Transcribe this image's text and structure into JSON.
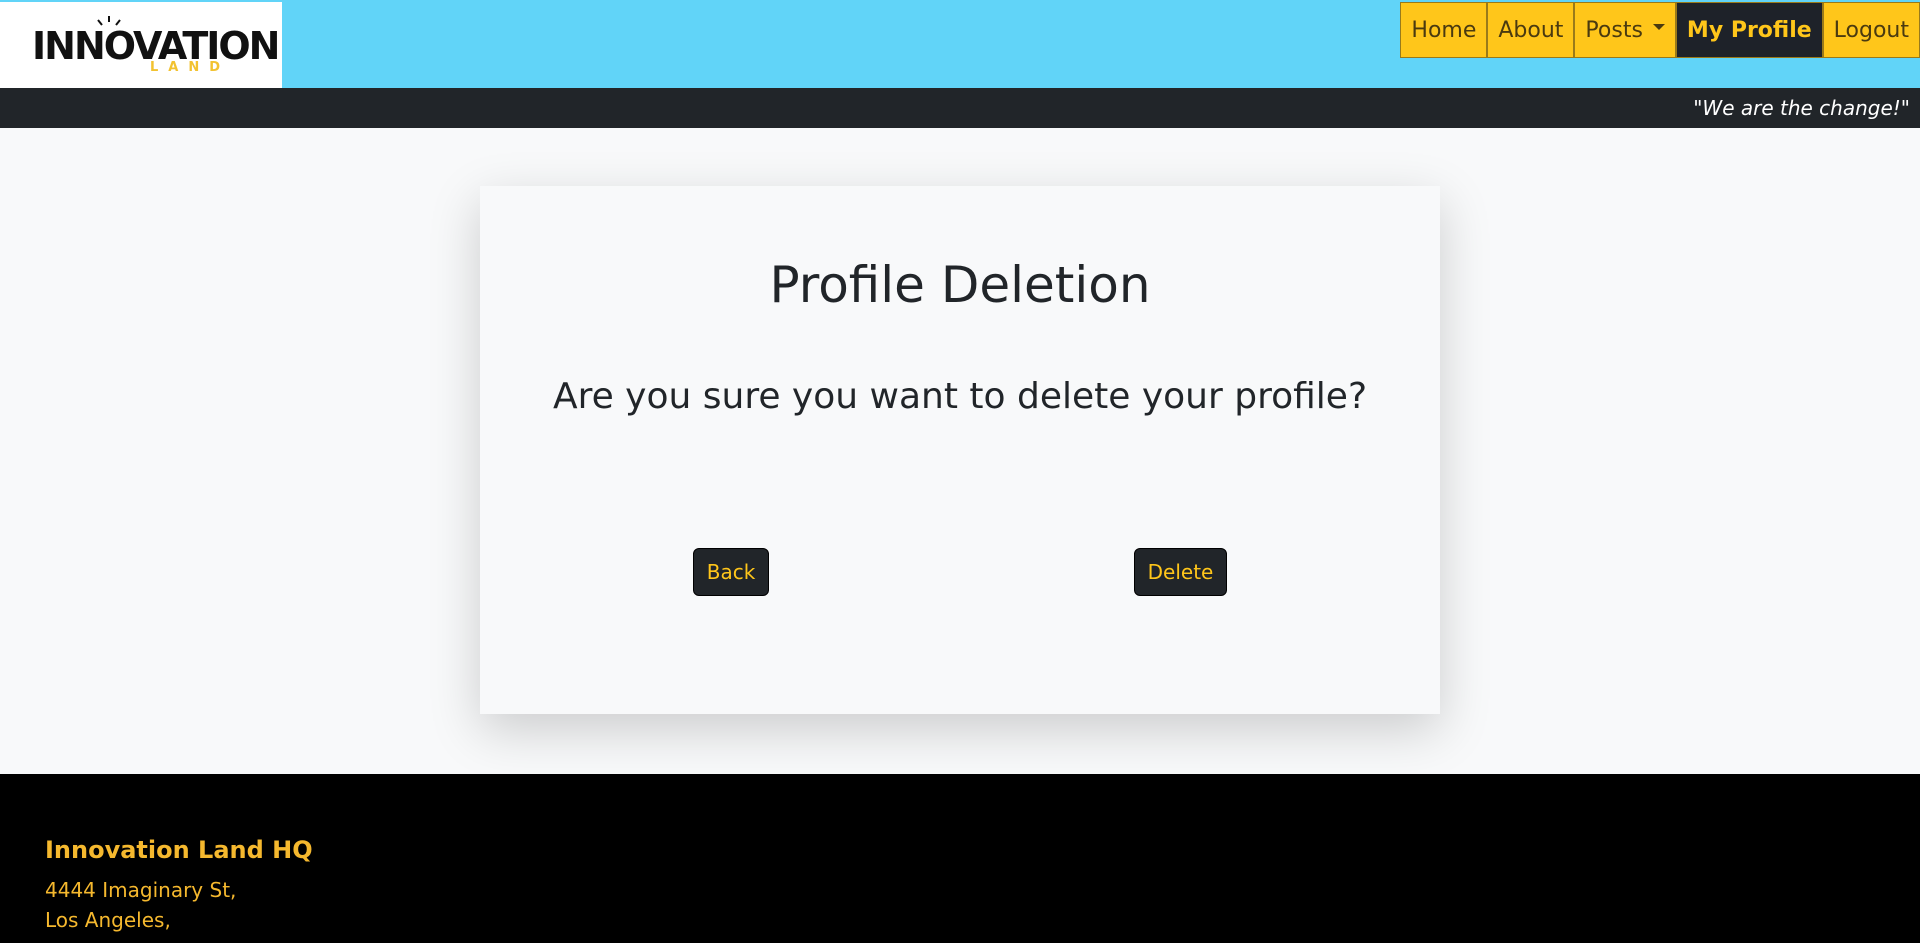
{
  "brand": {
    "logo_text": "INNOVATION",
    "logo_sub": "LAND",
    "logo_icon": "lightbulb-icon"
  },
  "nav": {
    "items": [
      {
        "label": "Home"
      },
      {
        "label": "About"
      },
      {
        "label": "Posts",
        "has_dropdown": true
      },
      {
        "label": "My Profile",
        "active": true
      },
      {
        "label": "Logout"
      }
    ]
  },
  "tagline": "\"We are the change!\"",
  "card": {
    "title": "Profile Deletion",
    "question": "Are you sure you want to delete your profile?",
    "back_label": "Back",
    "delete_label": "Delete"
  },
  "footer": {
    "title": "Innovation Land HQ",
    "address_line1": "4444 Imaginary St,",
    "address_line2": "Los Angeles,"
  },
  "colors": {
    "header_bg": "#61d4f8",
    "nav_bg": "#ffc61a",
    "dark": "#212529",
    "accent": "#f5b82e"
  }
}
